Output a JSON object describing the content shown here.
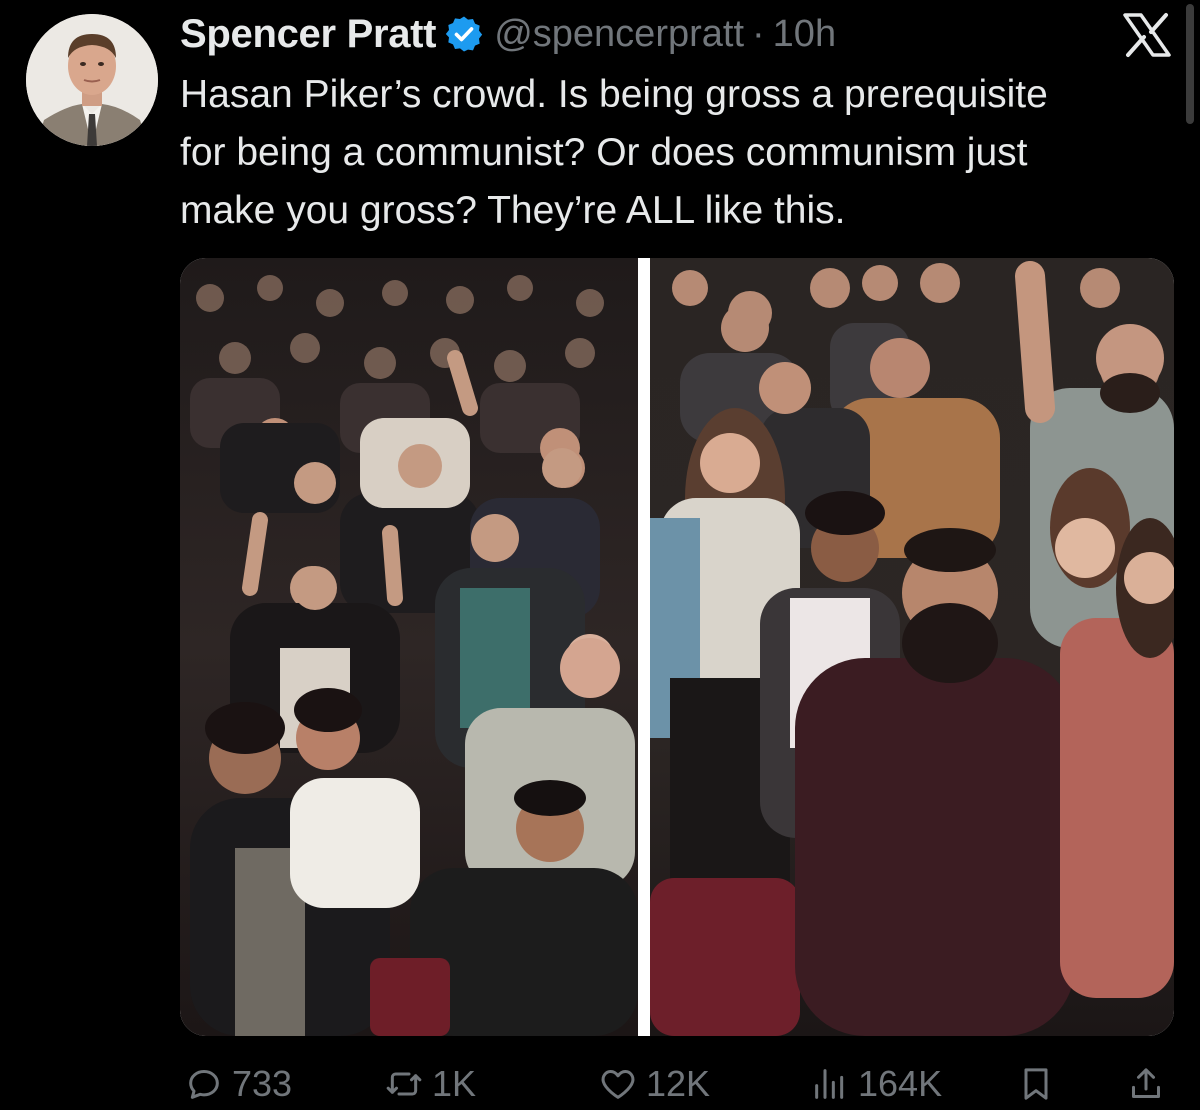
{
  "author": {
    "display_name": "Spencer Pratt",
    "handle": "@spencerpratt",
    "separator": "·",
    "timestamp": "10h",
    "verified": true,
    "verified_color": "#1d9bf0"
  },
  "post": {
    "text": "Hasan Piker’s crowd. Is being gross a prerequisite\nfor being a communist? Or does communism just\nmake you gross? They’re ALL like this."
  },
  "media": {
    "count": 2
  },
  "engagement": {
    "replies": "733",
    "reposts": "1K",
    "likes": "12K",
    "views": "164K"
  },
  "icons": {
    "reply": "reply-icon",
    "repost": "repost-icon",
    "like": "heart-icon",
    "views": "views-icon",
    "bookmark": "bookmark-icon",
    "share": "share-icon",
    "brand": "x-logo-icon",
    "verified": "verified-badge-icon"
  },
  "colors": {
    "background": "#000000",
    "primary_text": "#e7e9ea",
    "secondary_text": "#71767b",
    "accent": "#1d9bf0"
  }
}
